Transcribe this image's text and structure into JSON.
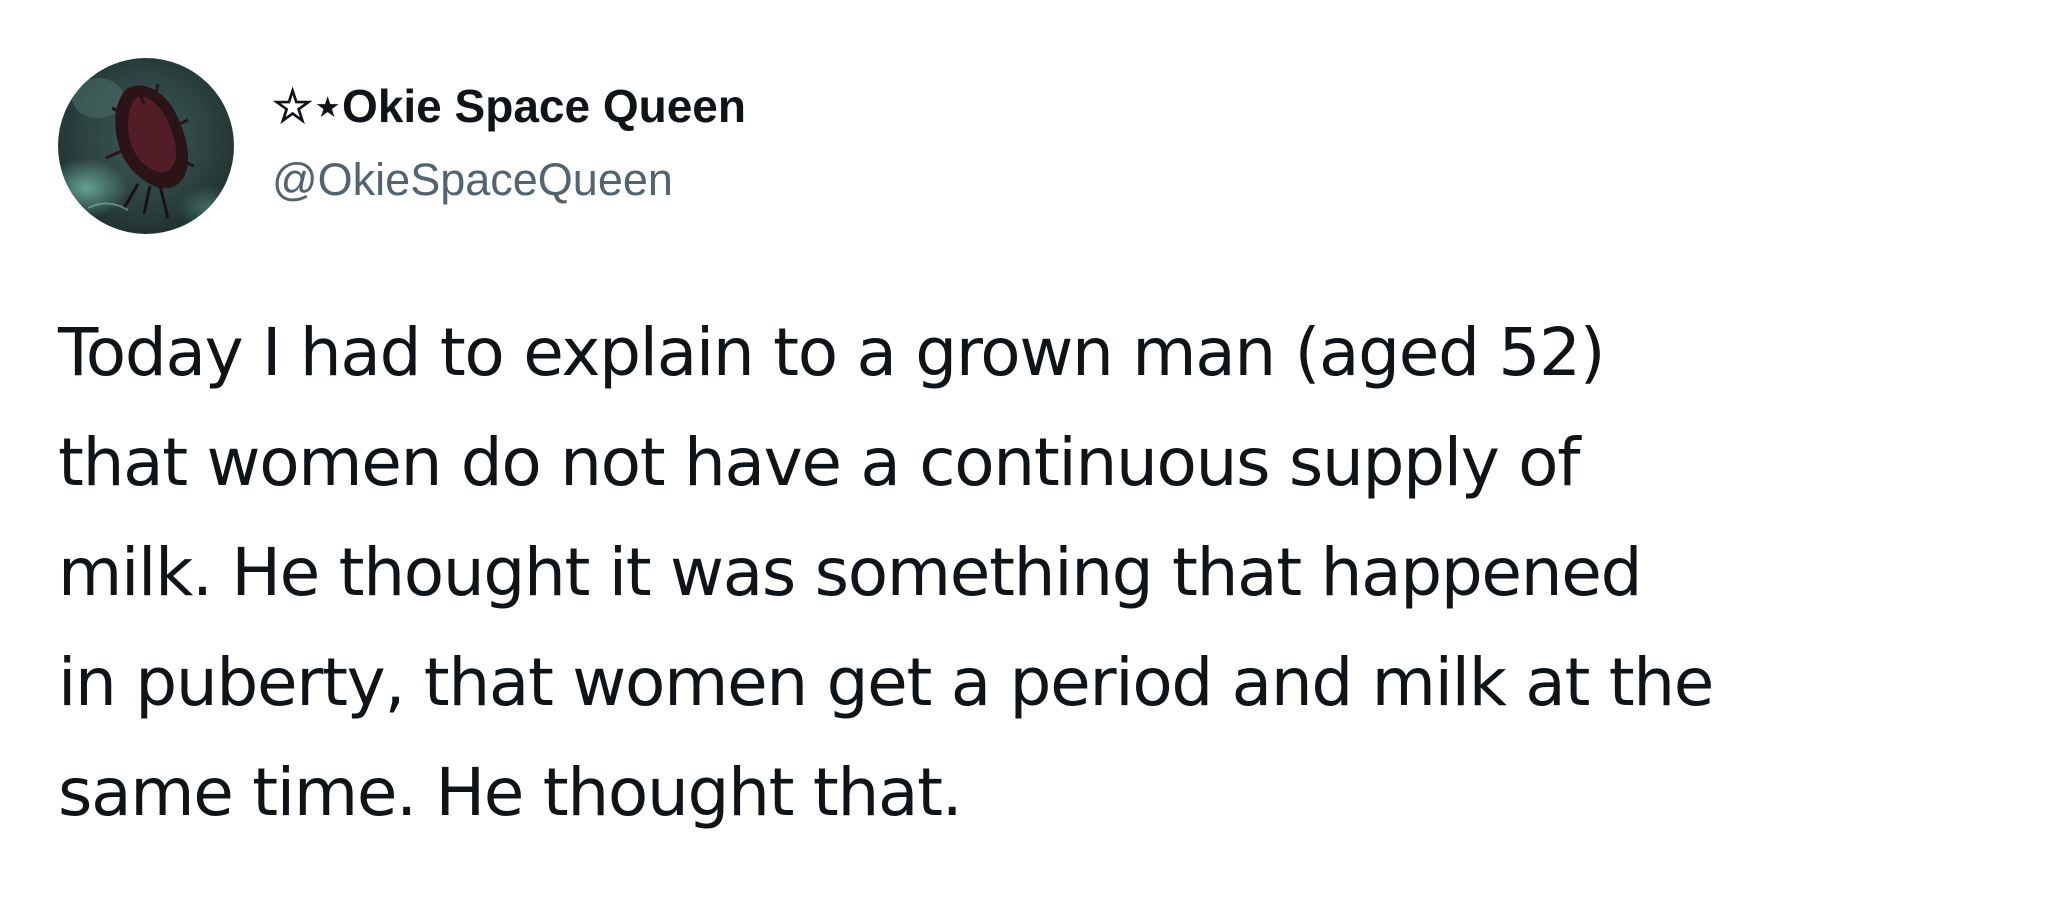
{
  "tweet": {
    "author": {
      "display_name": "☆⋆Okie Space Queen",
      "handle": "@OkieSpaceQueen",
      "avatar_icon": "profile-photo",
      "handle_color": "#536471"
    },
    "text_lines": [
      "Today I had to explain to a grown man (aged 52)",
      "that women do not have a continuous supply of",
      "milk. He thought it was something that happened",
      "in puberty, that women get a period and milk at the",
      "same time. He thought that."
    ],
    "text_color": "#0f1419"
  }
}
